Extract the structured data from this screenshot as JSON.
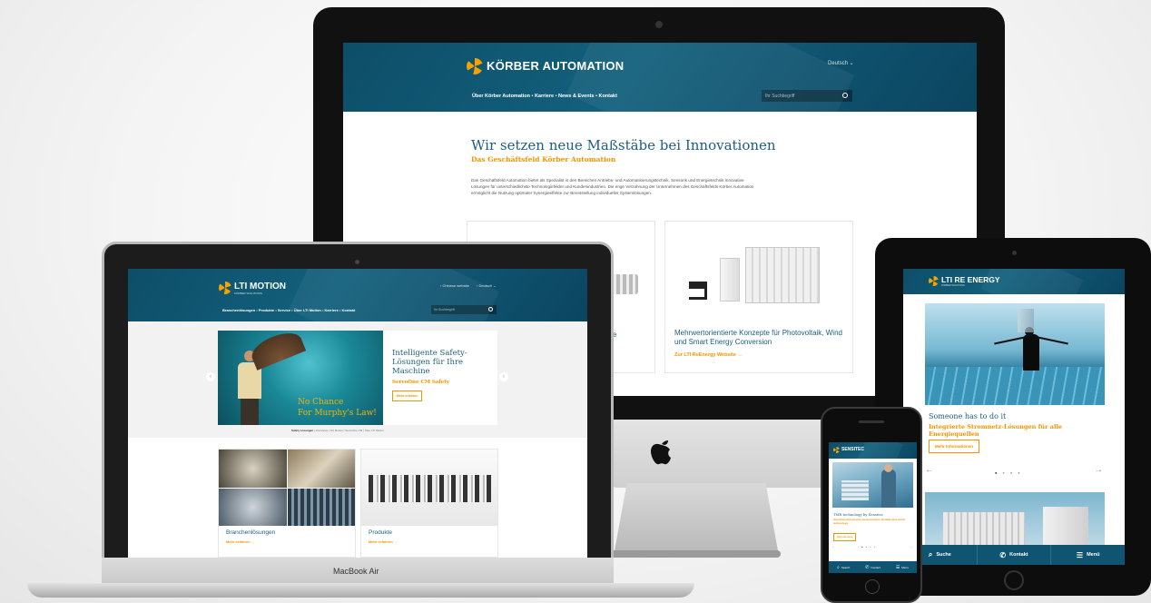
{
  "imac": {
    "logo": "KÖRBER AUTOMATION",
    "lang": "Deutsch",
    "nav": [
      "Über Körber Automation",
      "Karriere",
      "News & Events",
      "Kontakt"
    ],
    "search_placeholder": "Ihr Suchbegriff",
    "headline": "Wir setzen neue Maßstäbe bei Innovationen",
    "subheadline": "Das Geschäftsfeld Körber Automation",
    "body": "Das Geschäftsfeld Automation bietet als Spezialist in den Bereichen Antriebs- und Automatisierungstechnik, Sensorik und Energietechnik innovative Lösungen für unterschiedlichste Technologiefelder und Kundenindustrien. Die enge Verzahnung der Unternehmen des Geschäftsfelds Körber Automation ermöglicht die Nutzung optimaler Synergieeffekte zur Bereitstellung individueller Systemlösungen.",
    "card_left_fragment": "e",
    "card_right_title": "Mehrwertorientierte Konzepte für Photovoltaik, Wind und Smart Energy Conversion",
    "card_right_link": "Zur LTI ReEnergy Website →"
  },
  "macbook": {
    "label": "MacBook Air",
    "logo": "LTI MOTION",
    "logo_sub": "KÖRBER SOLUTIONS",
    "top_links": [
      "Chinese website",
      "Deutsch"
    ],
    "nav": [
      "Branchenlösungen",
      "Produkte",
      "Service",
      "Über LTI Motion",
      "Karriere",
      "Kontakt"
    ],
    "search_placeholder": "Ihr Suchbegriff",
    "banner_line1": "No Chance",
    "banner_line2": "For Murphy's Law!",
    "slide_title": "Intelligente Safety-Lösungen für Ihre Maschine",
    "slide_sub": "ServoOne CM Safety",
    "slide_btn": "Mehr erfahren",
    "slider_tabs": [
      "Safety Lösungen",
      "Interviews",
      "SO Motion",
      "ServoOne CM",
      "Über LTI Motion"
    ],
    "tile1_title": "Branchenlösungen",
    "tile1_link": "Mehr erfahren →",
    "tile2_title": "Produkte",
    "tile2_link": "Mehr erfahren →"
  },
  "tablet": {
    "logo": "LTI RE ENERGY",
    "logo_sub": "KÖRBER SOLUTIONS",
    "headline": "Someone has to do it",
    "subheadline": "Integrierte Stromnetz-Lösungen für alle Energiequellen",
    "btn": "Mehr Informationen",
    "bottom_nav": [
      "Suche",
      "Kontakt",
      "Menü"
    ]
  },
  "phone": {
    "logo": "SENSITEC",
    "headline": "TMR technology by Sensitec",
    "sub": "Sensitive and precise measurement. Durable and smart technology.",
    "btn": "Find out more",
    "bottom_nav": [
      "Search",
      "Contact",
      "Menu"
    ]
  },
  "colors": {
    "brand_teal": "#13607d",
    "accent_orange": "#f29400"
  }
}
